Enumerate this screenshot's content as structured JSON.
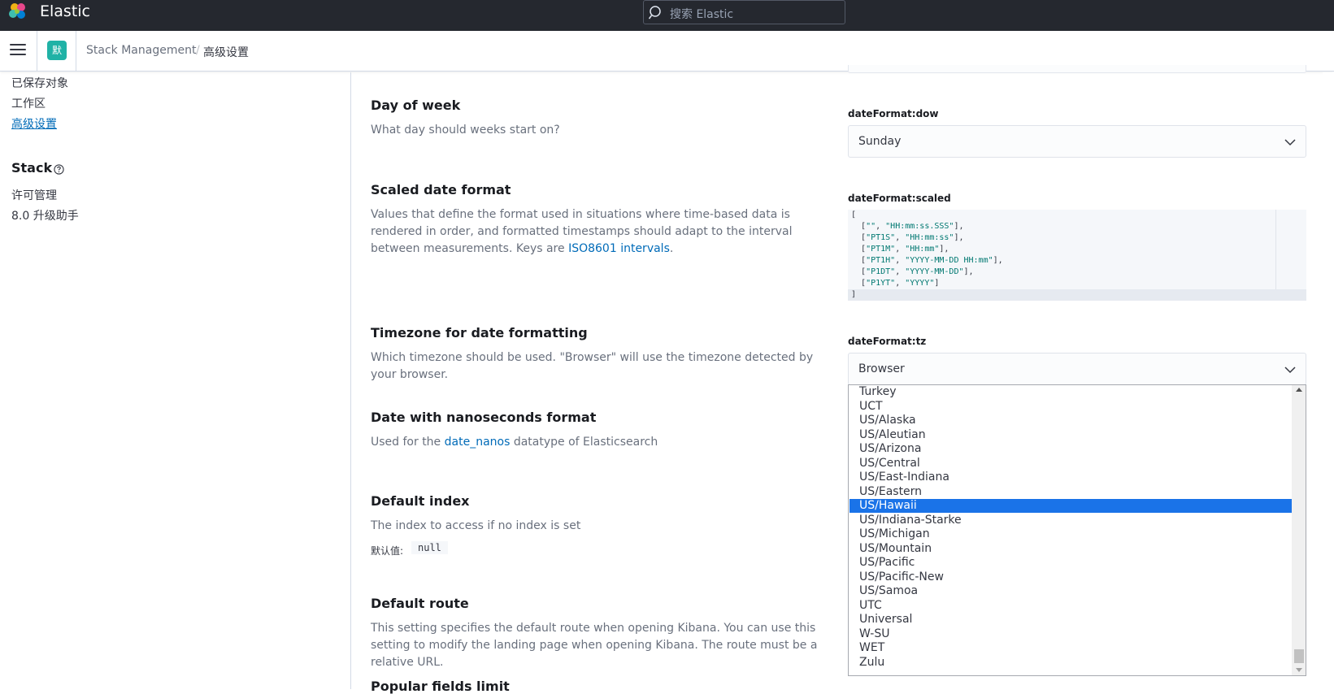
{
  "header": {
    "brand": "Elastic",
    "search_placeholder": "搜索 Elastic"
  },
  "subheader": {
    "space_initial": "默",
    "breadcrumbs": [
      {
        "label": "Stack Management"
      },
      {
        "label": "高级设置"
      }
    ],
    "separator": "/"
  },
  "sidebar": {
    "items_top": [
      {
        "label": "已保存对象"
      },
      {
        "label": "工作区"
      },
      {
        "label": "高级设置",
        "active": true
      }
    ],
    "stack_group": {
      "title": "Stack",
      "items": [
        {
          "label": "许可管理"
        },
        {
          "label": "8.0 升级助手"
        }
      ]
    }
  },
  "settings": {
    "day_of_week": {
      "title": "Day of week",
      "description": "What day should weeks start on?",
      "key": "dateFormat:dow",
      "value": "Sunday"
    },
    "scaled_date": {
      "title": "Scaled date format",
      "description_1": "Values that define the format used in situations where time-based data is rendered in order, and formatted timestamps should adapt to the interval between measurements. Keys are ",
      "link": "ISO8601 intervals",
      "description_2": ".",
      "key": "dateFormat:scaled",
      "code_lines": [
        {
          "text": "["
        },
        {
          "a": "\"\"",
          "b": "\"HH:mm:ss.SSS\"",
          "end": "],"
        },
        {
          "a": "\"PT1S\"",
          "b": "\"HH:mm:ss\"",
          "end": "],"
        },
        {
          "a": "\"PT1M\"",
          "b": "\"HH:mm\"",
          "end": "],"
        },
        {
          "a": "\"PT1H\"",
          "b": "\"YYYY-MM-DD HH:mm\"",
          "end": "],"
        },
        {
          "a": "\"P1DT\"",
          "b": "\"YYYY-MM-DD\"",
          "end": "],"
        },
        {
          "a": "\"P1YT\"",
          "b": "\"YYYY\"",
          "end": "]"
        },
        {
          "text": "]"
        }
      ]
    },
    "timezone": {
      "title": "Timezone for date formatting",
      "description": "Which timezone should be used. \"Browser\" will use the timezone detected by your browser.",
      "key": "dateFormat:tz",
      "value": "Browser"
    },
    "nanos": {
      "title": "Date with nanoseconds format",
      "description_1": "Used for the ",
      "link": "date_nanos",
      "description_2": " datatype of Elasticsearch"
    },
    "default_index": {
      "title": "Default index",
      "description": "The index to access if no index is set",
      "default_label": "默认值:",
      "default_value": "null"
    },
    "default_route": {
      "title": "Default route",
      "description": "This setting specifies the default route when opening Kibana. You can use this setting to modify the landing page when opening Kibana. The route must be a relative URL."
    },
    "popular_fields": {
      "title": "Popular fields limit"
    }
  },
  "timezone_dropdown": {
    "options": [
      "Turkey",
      "UCT",
      "US/Alaska",
      "US/Aleutian",
      "US/Arizona",
      "US/Central",
      "US/East-Indiana",
      "US/Eastern",
      "US/Hawaii",
      "US/Indiana-Starke",
      "US/Michigan",
      "US/Mountain",
      "US/Pacific",
      "US/Pacific-New",
      "US/Samoa",
      "UTC",
      "Universal",
      "W-SU",
      "WET",
      "Zulu"
    ],
    "highlighted": "US/Hawaii"
  }
}
